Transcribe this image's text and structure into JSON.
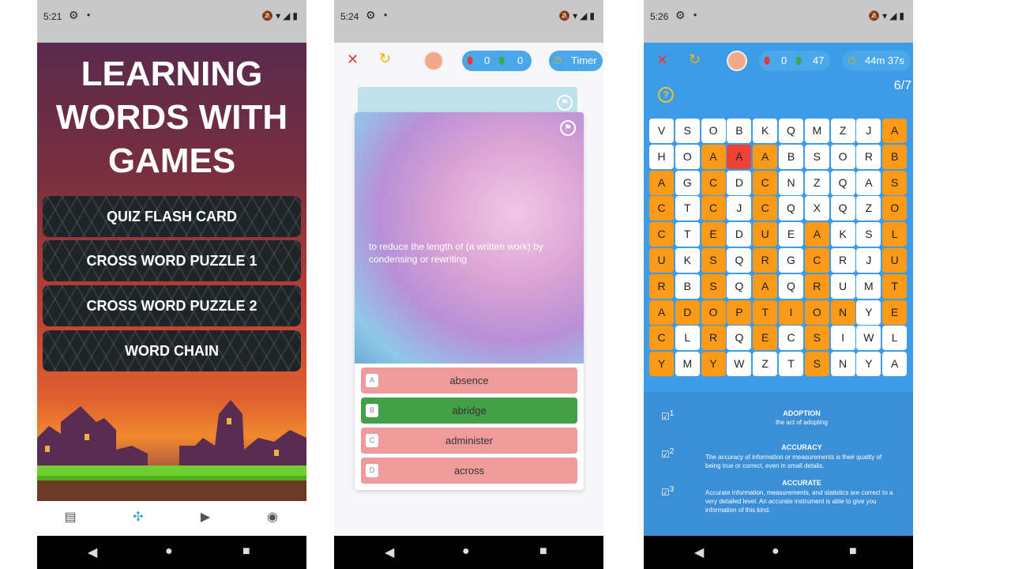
{
  "phone1": {
    "status_time": "5:21",
    "title_lines": [
      "LEARNING",
      "WORDS WITH",
      "GAMES"
    ],
    "menu": [
      "QUIZ FLASH CARD",
      "CROSS WORD PUZZLE 1",
      "CROSS WORD PUZZLE 2",
      "WORD CHAIN"
    ],
    "tabs": [
      "document-icon",
      "gamepad-icon",
      "video-icon",
      "profile-icon"
    ]
  },
  "phone2": {
    "status_time": "5:24",
    "score_red": "0",
    "score_green": "0",
    "timer_label": "Timer",
    "definition": "to reduce the length of (a written work) by condensing or rewriting",
    "options": [
      {
        "letter": "A",
        "text": "absence"
      },
      {
        "letter": "B",
        "text": "abridge"
      },
      {
        "letter": "C",
        "text": "administer"
      },
      {
        "letter": "D",
        "text": "across"
      }
    ],
    "correct_index": 1
  },
  "phone3": {
    "status_time": "5:26",
    "score_red": "0",
    "score_green": "47",
    "timer_label": "44m 37s",
    "progress": "6/7",
    "grid": [
      [
        "V",
        "S",
        "O",
        "B",
        "K",
        "Q",
        "M",
        "Z",
        "J",
        "A"
      ],
      [
        "H",
        "O",
        "A",
        "A",
        "A",
        "B",
        "S",
        "O",
        "R",
        "B"
      ],
      [
        "A",
        "G",
        "C",
        "D",
        "C",
        "N",
        "Z",
        "Q",
        "A",
        "S"
      ],
      [
        "C",
        "T",
        "C",
        "J",
        "C",
        "Q",
        "X",
        "Q",
        "Z",
        "O"
      ],
      [
        "C",
        "T",
        "E",
        "D",
        "U",
        "E",
        "A",
        "K",
        "S",
        "L"
      ],
      [
        "U",
        "K",
        "S",
        "Q",
        "R",
        "G",
        "C",
        "R",
        "J",
        "U"
      ],
      [
        "R",
        "B",
        "S",
        "Q",
        "A",
        "Q",
        "R",
        "U",
        "M",
        "T"
      ],
      [
        "A",
        "D",
        "O",
        "P",
        "T",
        "I",
        "O",
        "N",
        "Y",
        "E"
      ],
      [
        "C",
        "L",
        "R",
        "Q",
        "E",
        "C",
        "S",
        "I",
        "W",
        "L"
      ],
      [
        "Y",
        "M",
        "Y",
        "W",
        "Z",
        "T",
        "S",
        "N",
        "Y",
        "A"
      ]
    ],
    "highlight": [
      [
        0,
        0,
        0,
        0,
        0,
        0,
        0,
        0,
        0,
        1
      ],
      [
        0,
        0,
        1,
        2,
        1,
        0,
        0,
        0,
        0,
        1
      ],
      [
        1,
        0,
        1,
        0,
        1,
        0,
        0,
        0,
        0,
        1
      ],
      [
        1,
        0,
        1,
        0,
        1,
        0,
        0,
        0,
        0,
        1
      ],
      [
        1,
        0,
        1,
        0,
        1,
        0,
        1,
        0,
        0,
        1
      ],
      [
        1,
        0,
        1,
        0,
        1,
        0,
        1,
        0,
        0,
        1
      ],
      [
        1,
        0,
        1,
        0,
        1,
        0,
        1,
        0,
        0,
        1
      ],
      [
        1,
        1,
        1,
        1,
        1,
        1,
        1,
        1,
        0,
        1
      ],
      [
        1,
        0,
        1,
        0,
        1,
        0,
        1,
        0,
        0,
        0
      ],
      [
        1,
        0,
        1,
        0,
        0,
        0,
        1,
        0,
        0,
        0
      ]
    ],
    "definitions": [
      {
        "num": "1",
        "word": "ADOPTION",
        "text": "the act of adopting"
      },
      {
        "num": "2",
        "word": "ACCURACY",
        "text": "The accuracy of information or measurements is their quality of being true or correct, even in small details."
      },
      {
        "num": "3",
        "word": "ACCURATE",
        "text": "Accurate information, measurements, and statistics are correct to a very detailed level. An accurate instrument is able to give you information of this kind."
      }
    ]
  }
}
